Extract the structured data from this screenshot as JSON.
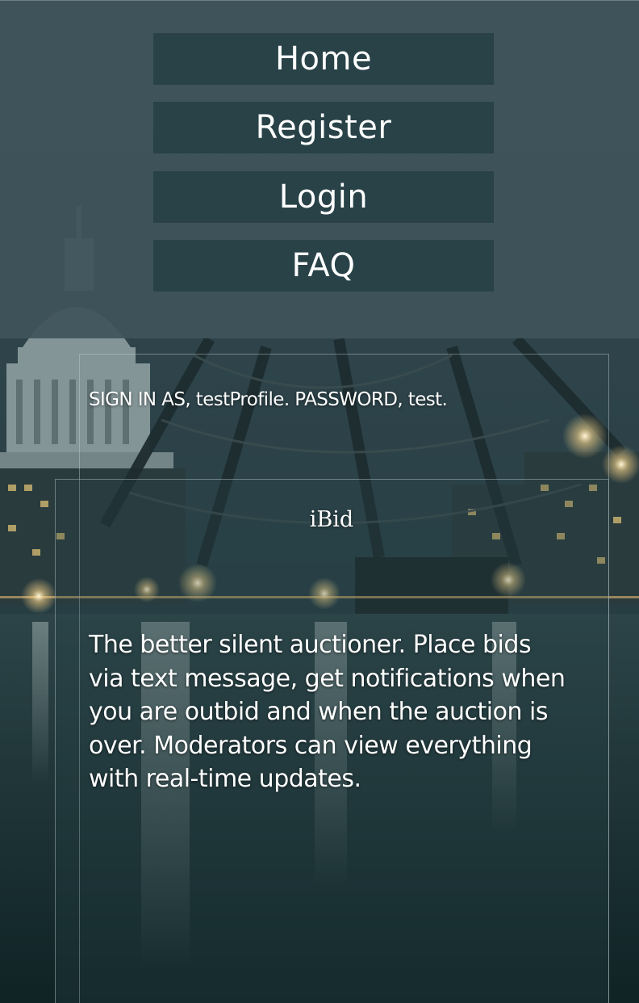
{
  "nav": {
    "home_label": "Home",
    "register_label": "Register",
    "login_label": "Login",
    "faq_label": "FAQ"
  },
  "content": {
    "signin_hint": "SIGN IN AS, testProfile. PASSWORD, test.",
    "brand_title": "iBid",
    "description": "The better silent auctioner. Place bids via text message, get notifications when you are outbid and when the auction is over. Moderators can view everything with real-time updates."
  },
  "colors": {
    "nav_panel": "#40545a",
    "nav_button": "#284248",
    "text": "#ffffff"
  },
  "icons": {
    "background": "night-city-bridge-photo"
  }
}
